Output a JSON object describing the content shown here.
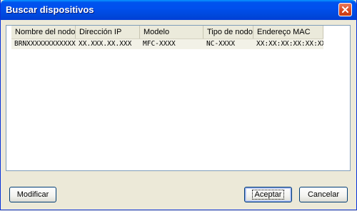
{
  "window": {
    "title": "Buscar dispositivos"
  },
  "table": {
    "columns": [
      "Nombre del nodo",
      "Dirección IP",
      "Modelo",
      "Tipo de nodo",
      "Endereço MAC"
    ],
    "rows": [
      [
        "BRNXXXXXXXXXXXX",
        "XX.XXX.XX.XXX",
        "MFC-XXXX",
        "NC-XXXX",
        "XX:XX:XX:XX:XX:XX"
      ]
    ]
  },
  "buttons": {
    "modify": "Modificar",
    "accept": "Aceptar",
    "cancel": "Cancelar"
  },
  "colors": {
    "titlebar": "#0050ee",
    "close": "#d9461d",
    "dialog_bg": "#ece9d8",
    "row_bg": "#f2f1e7"
  }
}
